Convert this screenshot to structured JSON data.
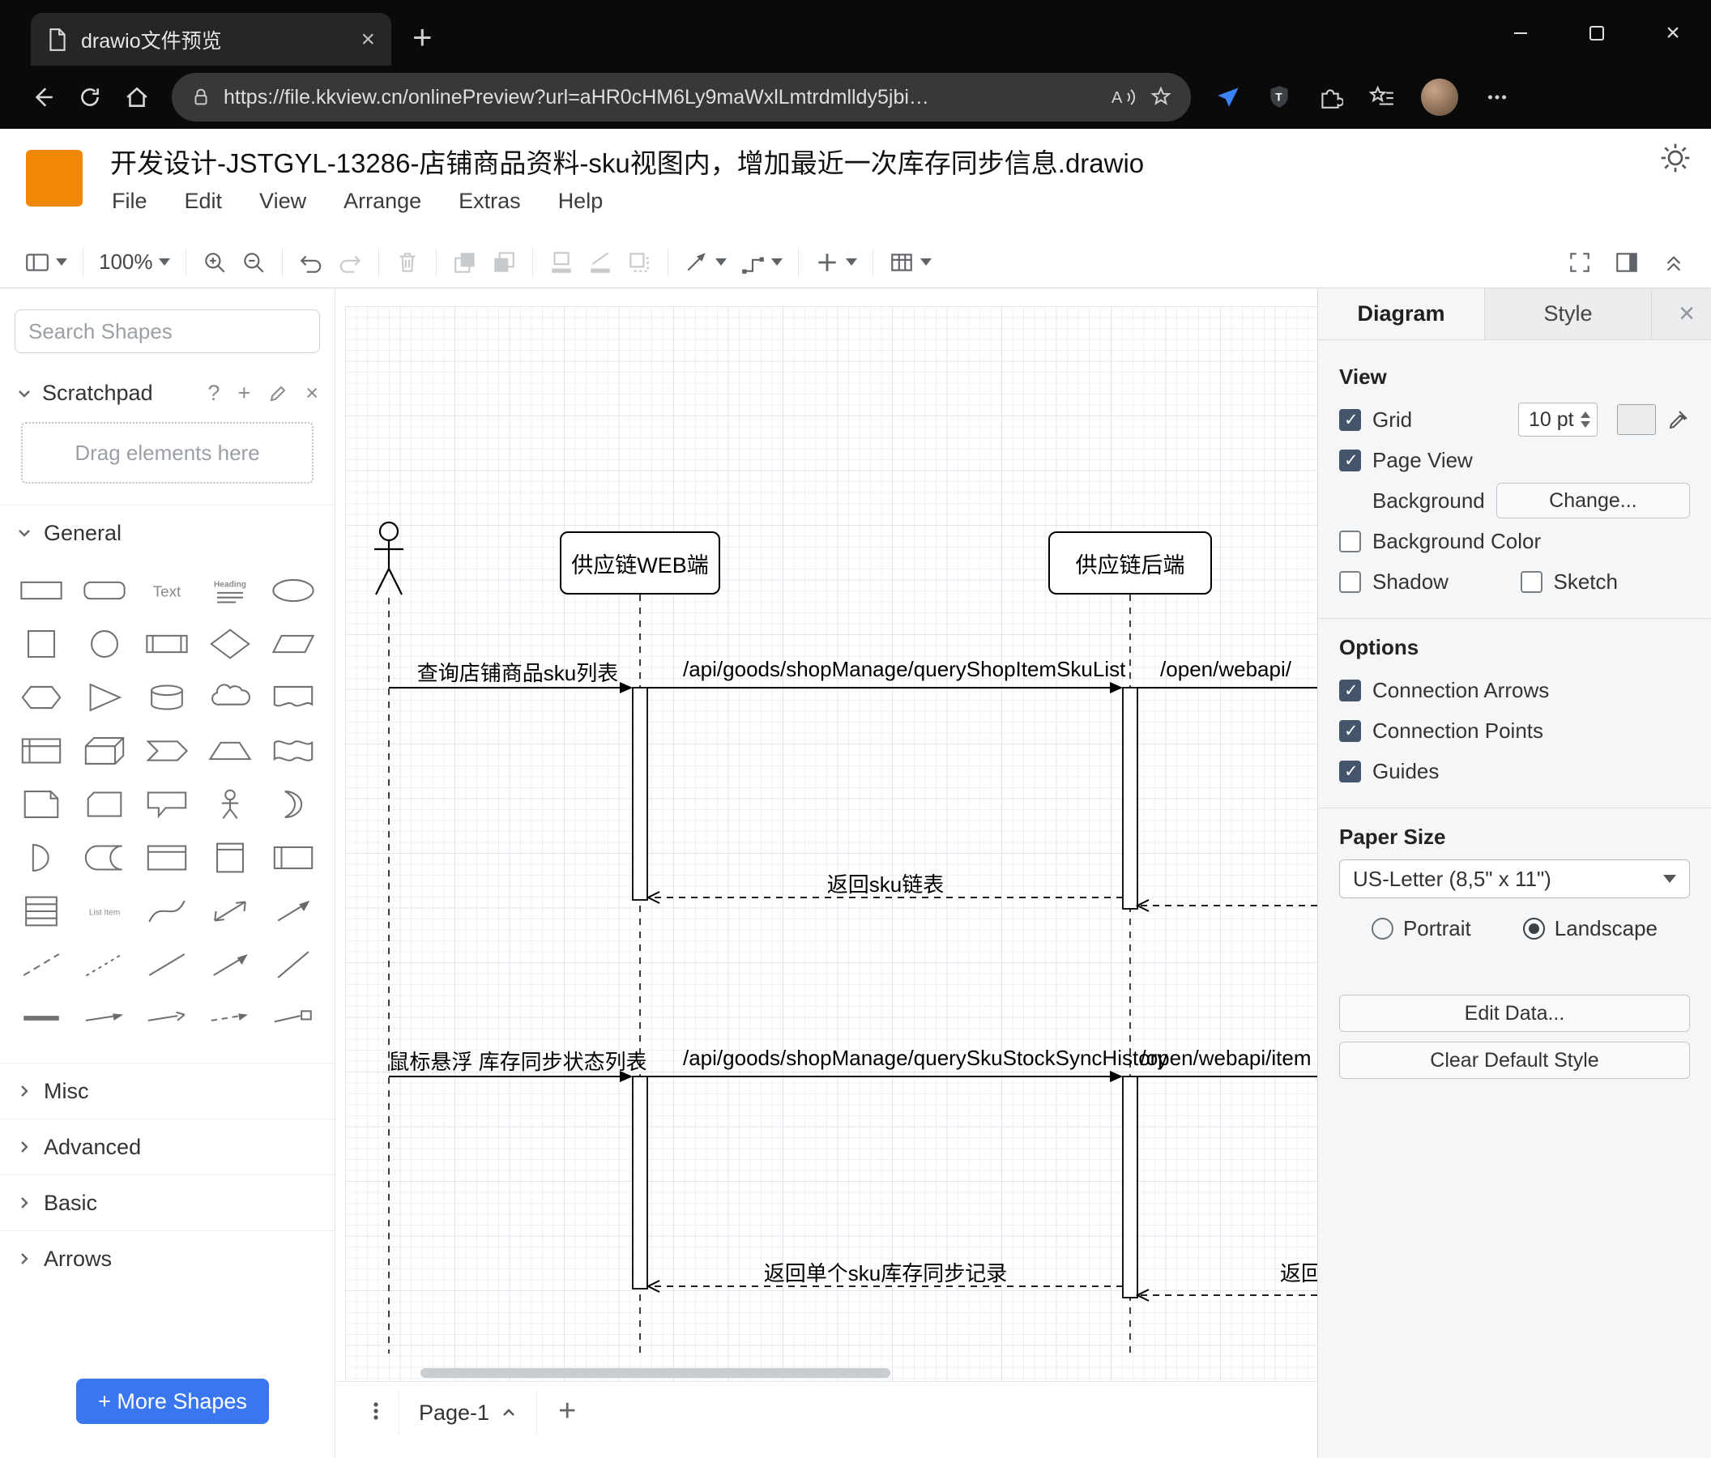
{
  "browser": {
    "tab_title": "drawio文件预览",
    "url": "https://file.kkview.cn/onlinePreview?url=aHR0cHM6Ly9maWxlLmtrdmlldy5jbi…",
    "shield_letter": "T"
  },
  "app": {
    "title": "开发设计-JSTGYL-13286-店铺商品资料-sku视图内，增加最近一次库存同步信息.drawio",
    "menu": [
      "File",
      "Edit",
      "View",
      "Arrange",
      "Extras",
      "Help"
    ],
    "zoom_level": "100%"
  },
  "sidebar": {
    "search_placeholder": "Search Shapes",
    "scratchpad_label": "Scratchpad",
    "drag_hint": "Drag elements here",
    "sections": [
      "General",
      "Misc",
      "Advanced",
      "Basic",
      "Arrows"
    ],
    "more_shapes_label": "+ More Shapes",
    "palette_text": {
      "text": "Text",
      "heading": "Heading",
      "list_item": "List Item"
    },
    "palette": [
      "rectangle",
      "rounded-rectangle",
      "text",
      "heading",
      "ellipse",
      "square",
      "circle",
      "process",
      "diamond",
      "parallelogram",
      "hexagon",
      "triangle",
      "cylinder",
      "cloud",
      "document",
      "internal-storage",
      "cube",
      "step",
      "trapezoid",
      "tape",
      "note",
      "card",
      "callout",
      "actor",
      "or",
      "and",
      "data-storage",
      "container",
      "vertical-container",
      "horizontal-container",
      "list",
      "list-item",
      "curve",
      "bidirectional-arrow",
      "arrow",
      "dashed-line",
      "dotted-line",
      "line",
      "arrow-ne",
      "line-ne",
      "bold-line",
      "link",
      "directional-connector",
      "dashed-connector",
      "connector-box"
    ]
  },
  "canvas": {
    "lifelines": [
      "供应链WEB端",
      "供应链后端"
    ],
    "messages": {
      "m1": "查询店铺商品sku列表",
      "m2": "/api/goods/shopManage/queryShopItemSkuList",
      "m3": "/open/webapi/",
      "r1": "返回sku链表",
      "m4": "鼠标悬浮 库存同步状态列表",
      "m5": "/api/goods/shopManage/querySkuStockSyncHistory",
      "m6": "/open/webapi/item",
      "r2": "返回单个sku库存同步记录",
      "r3": "返回"
    },
    "page_tab": "Page-1"
  },
  "format": {
    "tabs": [
      "Diagram",
      "Style"
    ],
    "view_heading": "View",
    "grid_label": "Grid",
    "grid_value": "10 pt",
    "page_view_label": "Page View",
    "background_label": "Background",
    "change_button": "Change...",
    "background_color_label": "Background Color",
    "shadow_label": "Shadow",
    "sketch_label": "Sketch",
    "options_heading": "Options",
    "options": [
      "Connection Arrows",
      "Connection Points",
      "Guides"
    ],
    "paper_heading": "Paper Size",
    "paper_size": "US-Letter (8,5\" x 11\")",
    "portrait_label": "Portrait",
    "landscape_label": "Landscape",
    "edit_data_button": "Edit Data...",
    "clear_style_button": "Clear Default Style"
  },
  "colors": {
    "logo_orange": "#F08705",
    "more_shapes_blue": "#3A76F0",
    "checkbox_checked": "#44546A"
  }
}
